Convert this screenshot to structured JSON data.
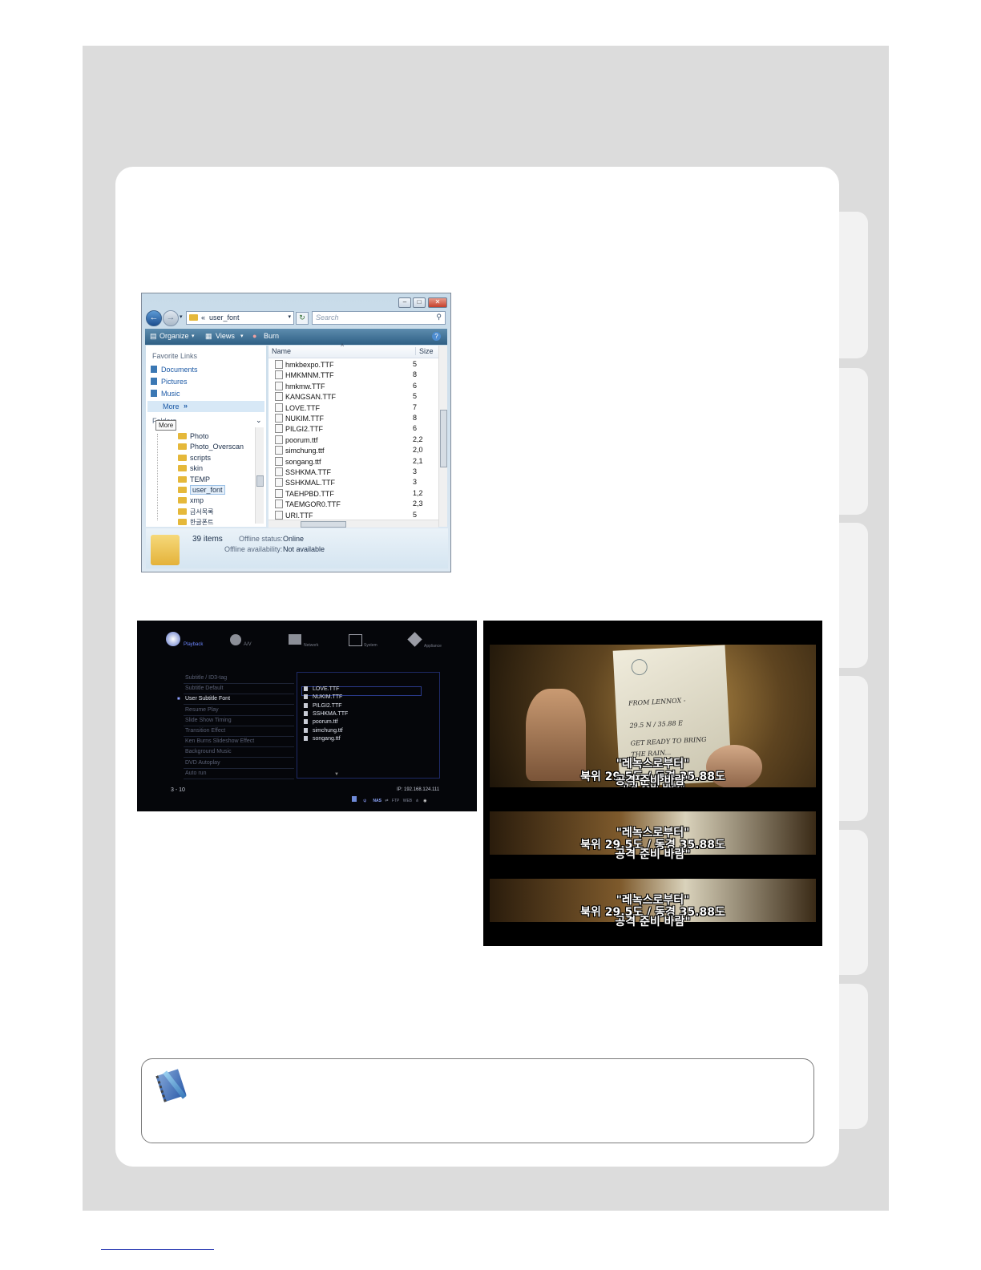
{
  "explorer": {
    "address": "user_font",
    "address_prefix": "«",
    "search_placeholder": "Search",
    "toolbar": {
      "organize": "Organize",
      "views": "Views",
      "burn": "Burn"
    },
    "favorite_links_title": "Favorite Links",
    "favorite_links": [
      "Documents",
      "Pictures",
      "Music",
      "More"
    ],
    "folders_label": "Folders",
    "tooltip": "More",
    "folder_tree": [
      "Photo",
      "Photo_Overscan",
      "scripts",
      "skin",
      "TEMP",
      "user_font",
      "xmp",
      "금서목록",
      "한글폰트"
    ],
    "selected_folder": "user_font",
    "columns": {
      "name": "Name",
      "size": "Size"
    },
    "files": [
      {
        "name": "hmkbexpo.TTF",
        "size": "5"
      },
      {
        "name": "HMKMNM.TTF",
        "size": "8"
      },
      {
        "name": "hmkmw.TTF",
        "size": "6"
      },
      {
        "name": "KANGSAN.TTF",
        "size": "5"
      },
      {
        "name": "LOVE.TTF",
        "size": "7"
      },
      {
        "name": "NUKIM.TTF",
        "size": "8"
      },
      {
        "name": "PILGI2.TTF",
        "size": "6"
      },
      {
        "name": "poorum.ttf",
        "size": "2,2"
      },
      {
        "name": "simchung.ttf",
        "size": "2,0"
      },
      {
        "name": "songang.ttf",
        "size": "2,1"
      },
      {
        "name": "SSHKMA.TTF",
        "size": "3"
      },
      {
        "name": "SSHKMAL.TTF",
        "size": "3"
      },
      {
        "name": "TAEHPBD.TTF",
        "size": "1,2"
      },
      {
        "name": "TAEMGOR0.TTF",
        "size": "2,3"
      },
      {
        "name": "URI.TTF",
        "size": "5"
      }
    ],
    "status": {
      "count": "39 items",
      "offline_status_label": "Offline status:",
      "offline_status_value": "Online",
      "offline_availability_label": "Offline availability:",
      "offline_availability_value": "Not available"
    }
  },
  "player_menu": {
    "top_tabs": [
      "Playback",
      "A/V",
      "Network",
      "System",
      "Appliance"
    ],
    "items": [
      {
        "label": "Subtitle / ID3-tag",
        "active": false
      },
      {
        "label": "Subtitle Default",
        "active": false
      },
      {
        "label": "User Subtitle Font",
        "active": true
      },
      {
        "label": "Resume Play",
        "active": false
      },
      {
        "label": "Slide Show Timing",
        "active": false
      },
      {
        "label": "Transition Effect",
        "active": false
      },
      {
        "label": "Ken Burns Slideshow Effect",
        "active": false
      },
      {
        "label": "Background Music",
        "active": false
      },
      {
        "label": "DVD Autoplay",
        "active": false
      },
      {
        "label": "Auto run",
        "active": false
      }
    ],
    "fonts": [
      "LOVE.TTF",
      "NUKIM.TTF",
      "PILGI2.TTF",
      "SSHKMA.TTF",
      "poorum.ttf",
      "simchung.ttf",
      "songang.ttf"
    ],
    "page_indicator": "3 - 10",
    "ip": "IP: 192.168.124.111",
    "status_icons": [
      "NAS",
      "FTP",
      "WEB"
    ]
  },
  "movie": {
    "handwriting": [
      "FROM LENNOX -",
      "29.5 N / 35.88 E",
      "GET READY TO BRING",
      "THE RAIN..."
    ],
    "subtitles": [
      {
        "line1": "\"레녹스로부터\"",
        "line2": "북위 29.5도 / 동경 35.88도",
        "line3": "공격 준비 바람\""
      },
      {
        "line1": "\"레녹스로부터\"",
        "line2": "북위 29.5도 / 동경 35.88도",
        "line3": "공격 준비 바람\""
      },
      {
        "line1": "\"레녹스로부터\"",
        "line2": "북위 29.5도 / 동경 35.88도",
        "line3": "공격 준비 바람\""
      }
    ]
  },
  "colors": {
    "background_frame": "#dcdcdc",
    "explorer_toolbar": "#2e5f84",
    "menu_background": "#05060a",
    "footer_link": "#2f3fb5"
  }
}
